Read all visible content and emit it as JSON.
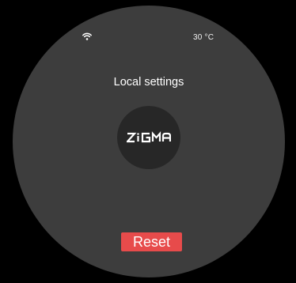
{
  "status_bar": {
    "wifi_icon": "wifi-icon",
    "temperature": "30 °C"
  },
  "page": {
    "title": "Local settings"
  },
  "logo": {
    "text": "ZiGMA",
    "icon": "zigma-logo"
  },
  "actions": {
    "reset_label": "Reset"
  },
  "colors": {
    "background": "#000000",
    "dial": "#3d3d3d",
    "logo_disc": "#272727",
    "reset_button": "#e74b4b",
    "text": "#ffffff"
  }
}
